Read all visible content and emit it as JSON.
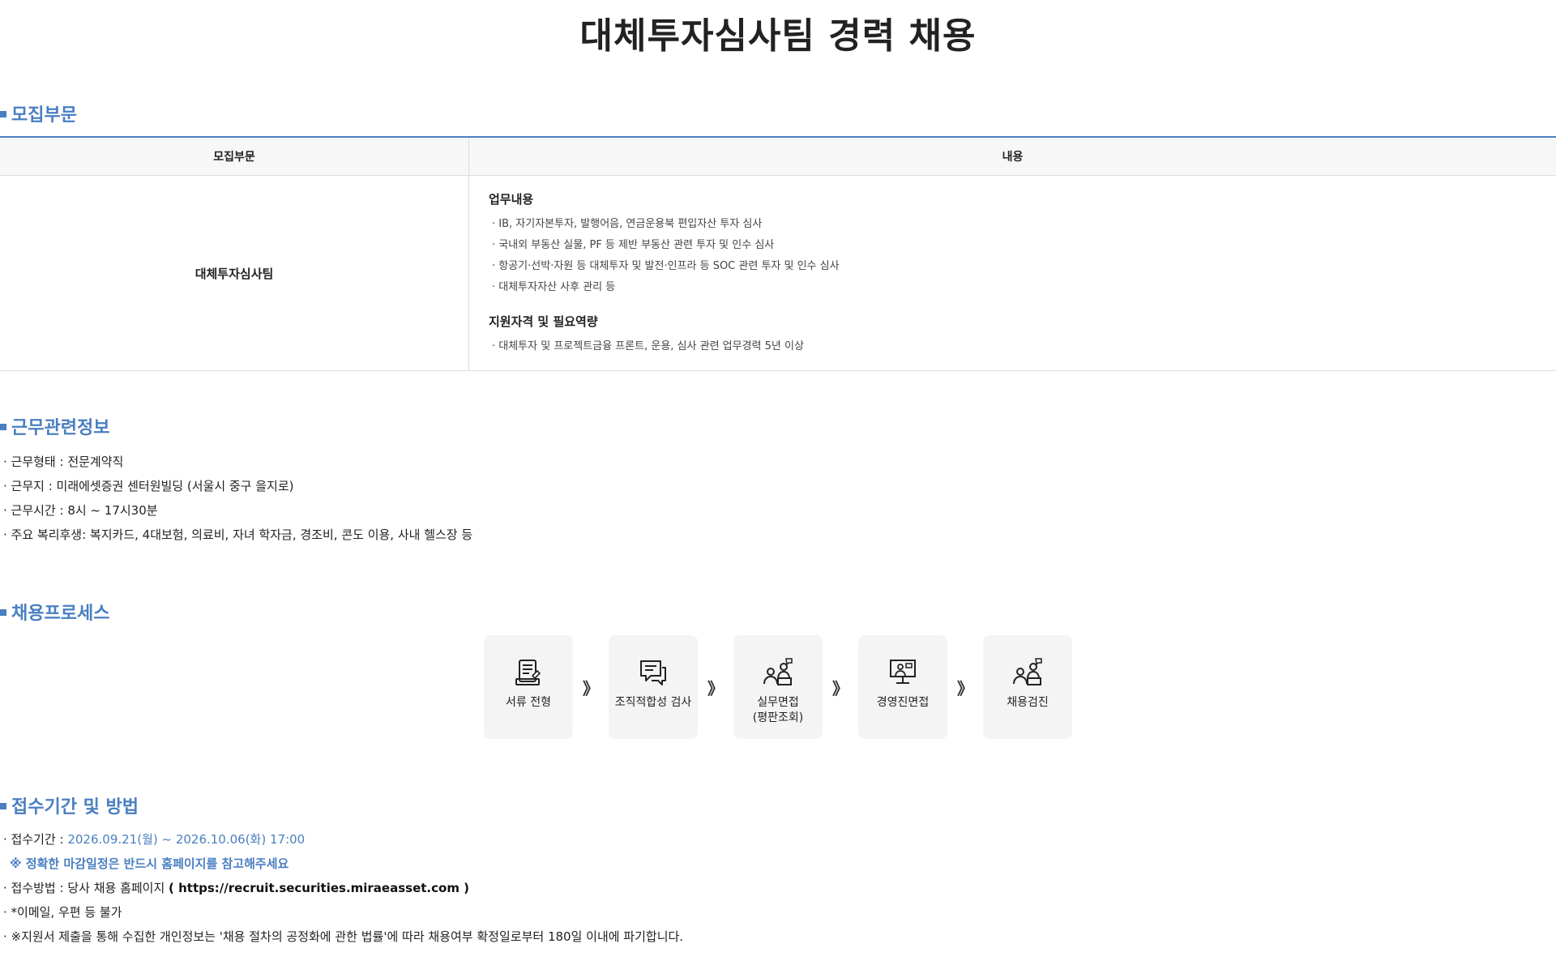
{
  "title": "대체투자심사팀 경력 채용",
  "sections": {
    "recruit": {
      "heading": "모집부문",
      "table_headers": [
        "모집부문",
        "내용"
      ],
      "department": "대체투자심사팀",
      "duties_heading": "업무내용",
      "duties": [
        "· IB, 자기자본투자, 발행어음, 연금운용북 편입자산 투자 심사",
        "· 국내외 부동산 실물, PF 등 제반 부동산 관련 투자 및 인수 심사",
        "· 항공기·선박·자원 등 대체투자 및 발전·인프라 등 SOC 관련 투자 및 인수 심사",
        "· 대체투자자산 사후 관리 등"
      ],
      "qual_heading": "지원자격 및 필요역량",
      "qualifications": [
        "· 대체투자 및 프로젝트금융 프론트, 운용, 심사 관련 업무경력 5년 이상"
      ]
    },
    "work": {
      "heading": "근무관련정보",
      "lines": [
        "· 근무형태 : 전문계약직",
        "· 근무지 : 미래에셋증권 센터원빌딩 (서울시 중구 을지로)",
        "· 근무시간 : 8시 ~ 17시30분",
        "· 주요 복리후생: 복지카드, 4대보험, 의료비, 자녀 학자금, 경조비, 콘도 이용, 사내 헬스장 등"
      ]
    },
    "process": {
      "heading": "채용프로세스",
      "steps": [
        {
          "label": "서류 전형",
          "icon": "document-icon"
        },
        {
          "label": "조직적합성 검사",
          "icon": "chat-icon"
        },
        {
          "label": "실무면접\n(평판조회)",
          "icon": "interview-icon"
        },
        {
          "label": "경영진면접",
          "icon": "monitor-presentation-icon"
        },
        {
          "label": "채용검진",
          "icon": "interview-icon"
        }
      ],
      "arrow": "》"
    },
    "apply": {
      "heading": "접수기간 및 방법",
      "period_label": "· 접수기간 : ",
      "period_value": "2026.09.21(월) ~ 2026.10.06(화) 17:00",
      "period_note": "※ 정확한 마감일정은 반드시 홈페이지를 참고해주세요",
      "method_label": "· 접수방법 : 당사 채용 홈페이지 ",
      "method_url": "( https://recruit.securities.miraeasset.com )",
      "no_email": "· *이메일, 우편 등 불가",
      "privacy": "· ※지원서 제출을 통해 수집한 개인정보는 '채용 절차의 공정화에 관한 법률'에 따라 채용여부 확정일로부터 180일 이내에 파기합니다."
    }
  },
  "colors": {
    "accent": "#4a7fc1",
    "step_bg": "#f4f4f4"
  }
}
